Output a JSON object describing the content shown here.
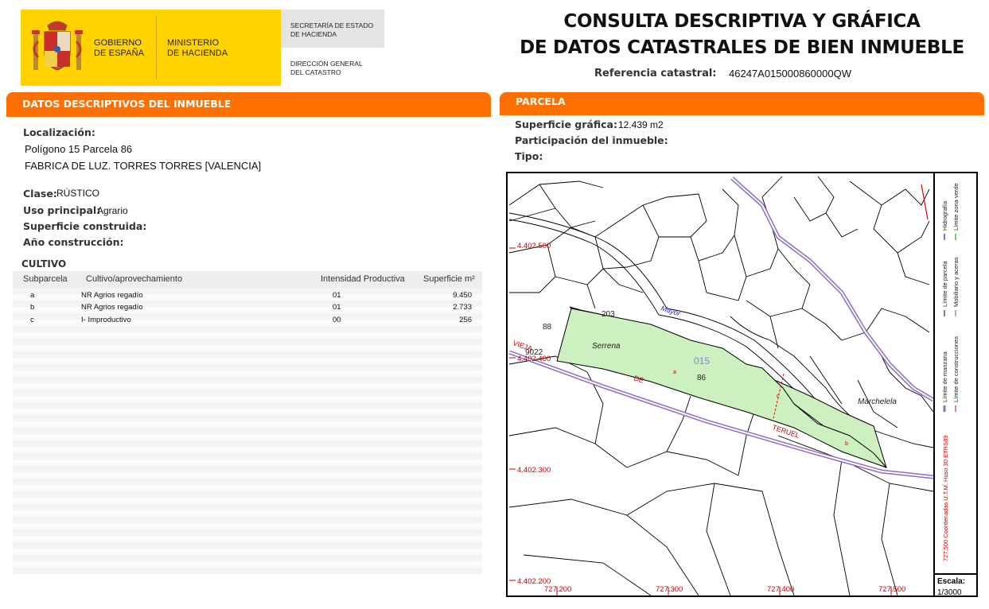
{
  "header": {
    "logo_left": [
      "GOBIERNO",
      "DE ESPAÑA"
    ],
    "logo_mid": [
      "MINISTERIO",
      "DE HACIENDA"
    ],
    "logo_right_top": [
      "SECRETARÍA DE ESTADO",
      "DE HACIENDA"
    ],
    "logo_right_bottom": [
      "DIRECCIÓN GENERAL",
      "DEL CATASTRO"
    ],
    "title_line1": "CONSULTA DESCRIPTIVA Y GRÁFICA",
    "title_line2": "DE DATOS CATASTRALES DE BIEN INMUEBLE",
    "ref_label": "Referencia catastral:",
    "ref_value": "46247A015000860000QW"
  },
  "left": {
    "section_title": "DATOS DESCRIPTIVOS DEL INMUEBLE",
    "localizacion_label": "Localización:",
    "localizacion_line1": "Polígono 15 Parcela 86",
    "localizacion_line2": "FABRICA DE LUZ. TORRES TORRES [VALENCIA]",
    "clase_label": "Clase:",
    "clase_value": "RÚSTICO",
    "uso_label": "Uso principal:",
    "uso_value": "Agrario",
    "superficie_label": "Superficie construida:",
    "anio_label": "Año construcción:",
    "cultivo_title": "CULTIVO",
    "table_headers": [
      "Subparcela",
      "Cultivo/aprovechamiento",
      "Intensidad Productiva",
      "Superficie m²"
    ],
    "table_rows": [
      [
        "a",
        "NR Agrios regadío",
        "01",
        "9.450"
      ],
      [
        "b",
        "NR Agrios regadío",
        "01",
        "2.733"
      ],
      [
        "c",
        "I- Improductivo",
        "00",
        "256"
      ]
    ]
  },
  "right": {
    "section_title": "PARCELA",
    "sup_grafica_label": "Superficie gráfica:",
    "sup_grafica_value": "12.439 m2",
    "participacion_label": "Participación del inmueble:",
    "tipo_label": "Tipo:"
  },
  "map": {
    "y_labels": [
      "4.402.500",
      "4.402.400",
      "4.402.300",
      "4.402.200"
    ],
    "x_labels": [
      "727.200",
      "727.300",
      "727.400",
      "727.500"
    ],
    "place_labels": [
      "Serrena",
      "Marchelela",
      "Mayor",
      "VIEJA",
      "DE",
      "TERUEL"
    ],
    "parcel_numbers": [
      "203",
      "88",
      "9022",
      "015",
      "86"
    ],
    "subparcel_letters": [
      "a",
      "b",
      "c"
    ],
    "legend_left": [
      "Límite de manzana",
      "Límite de parcela",
      "Hidrografía"
    ],
    "legend_right": [
      "Límite de construcciones",
      "Mobiliario y aceras",
      "Límite zona verde"
    ],
    "coord_note": "727.500 Coordenadas U.T.M. Huso 30 ETRS89",
    "scale_label": "Escala:",
    "scale_value": "1/3000",
    "colors": {
      "parcel_fill": "#cdf0c0",
      "road_stroke": "#8e6bc4",
      "grid_label": "#cc0000"
    }
  }
}
